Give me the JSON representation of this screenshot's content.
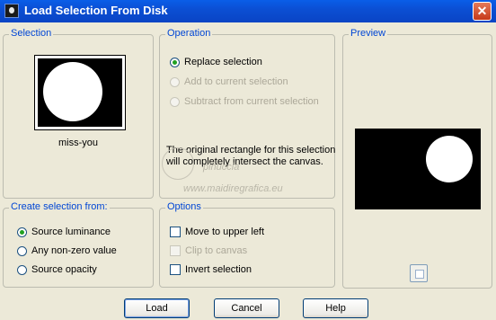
{
  "window": {
    "title": "Load Selection From Disk",
    "close_glyph": "✕"
  },
  "selection": {
    "label": "Selection",
    "file_name": "miss-you"
  },
  "operation": {
    "label": "Operation",
    "options": [
      {
        "label": "Replace selection",
        "checked": true,
        "enabled": true
      },
      {
        "label": "Add to current selection",
        "checked": false,
        "enabled": false
      },
      {
        "label": "Subtract from current selection",
        "checked": false,
        "enabled": false
      }
    ],
    "note": "The original rectangle for this selection will completely intersect the canvas."
  },
  "preview": {
    "label": "Preview"
  },
  "create_from": {
    "label": "Create selection from:",
    "options": [
      {
        "label": "Source luminance",
        "checked": true
      },
      {
        "label": "Any non-zero value",
        "checked": false
      },
      {
        "label": "Source opacity",
        "checked": false
      }
    ]
  },
  "options": {
    "label": "Options",
    "items": [
      {
        "label": "Move to upper left",
        "checked": false,
        "enabled": true
      },
      {
        "label": "Clip to canvas",
        "checked": false,
        "enabled": false
      },
      {
        "label": "Invert selection",
        "checked": false,
        "enabled": true
      }
    ]
  },
  "buttons": {
    "load": "Load",
    "cancel": "Cancel",
    "help": "Help"
  },
  "watermark": {
    "line1": "pinuccia",
    "line2": "www.maidiregrafica.eu"
  }
}
